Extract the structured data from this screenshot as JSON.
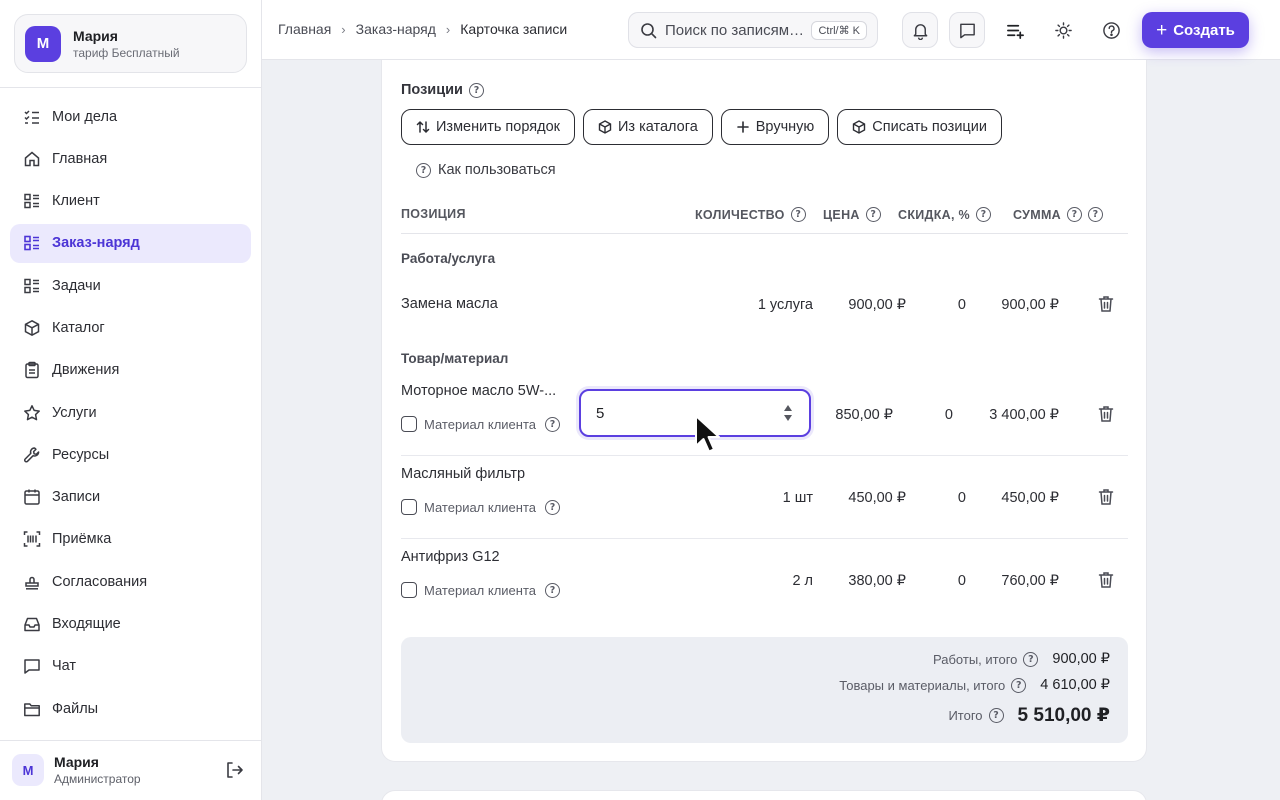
{
  "account": {
    "initial": "М",
    "name": "Мария",
    "plan": "тариф Бесплатный"
  },
  "nav": [
    {
      "label": "Мои дела",
      "icon": "checklist-icon"
    },
    {
      "label": "Главная",
      "icon": "home-icon"
    },
    {
      "label": "Клиент",
      "icon": "list-icon"
    },
    {
      "label": "Заказ-наряд",
      "icon": "list-icon",
      "active": true
    },
    {
      "label": "Задачи",
      "icon": "list-icon"
    },
    {
      "label": "Каталог",
      "icon": "cube-icon"
    },
    {
      "label": "Движения",
      "icon": "clipboard-icon"
    },
    {
      "label": "Услуги",
      "icon": "star-icon"
    },
    {
      "label": "Ресурсы",
      "icon": "wrench-icon"
    },
    {
      "label": "Записи",
      "icon": "calendar-icon"
    },
    {
      "label": "Приёмка",
      "icon": "barcode-icon"
    },
    {
      "label": "Согласования",
      "icon": "stamp-icon"
    },
    {
      "label": "Входящие",
      "icon": "inbox-icon"
    },
    {
      "label": "Чат",
      "icon": "chat-icon"
    },
    {
      "label": "Файлы",
      "icon": "folder-icon"
    }
  ],
  "user": {
    "initial": "М",
    "name": "Мария",
    "role": "Администратор"
  },
  "breadcrumbs": [
    "Главная",
    "Заказ-наряд",
    "Карточка записи"
  ],
  "search": {
    "placeholder": "Поиск по записям…",
    "shortcut": "Ctrl/⌘ K"
  },
  "header": {
    "create_label": "Создать"
  },
  "positions": {
    "title": "Позиции",
    "toolbar": [
      "Изменить порядок",
      "Из каталога",
      "Вручную",
      "Списать позиции"
    ],
    "howto": "Как пользоваться",
    "columns": {
      "position": "ПОЗИЦИЯ",
      "qty": "КОЛИЧЕСТВО",
      "price": "ЦЕНА",
      "discount": "СКИДКА, %",
      "sum": "СУММА"
    },
    "group_work": "Работа/услуга",
    "group_goods": "Товар/материал",
    "client_material": "Материал клиента",
    "rows": [
      {
        "name": "Замена масла",
        "qty": "1 услуга",
        "price": "900,00 ₽",
        "discount": "0",
        "sum": "900,00 ₽"
      },
      {
        "name": "Моторное масло 5W-...",
        "qty": "5",
        "price": "850,00 ₽",
        "discount": "0",
        "sum": "3 400,00 ₽"
      },
      {
        "name": "Масляный фильтр",
        "qty": "1 шт",
        "price": "450,00 ₽",
        "discount": "0",
        "sum": "450,00 ₽"
      },
      {
        "name": "Антифриз G12",
        "qty": "2 л",
        "price": "380,00 ₽",
        "discount": "0",
        "sum": "760,00 ₽"
      }
    ]
  },
  "summary": {
    "work_label": "Работы, итого",
    "work_value": "900,00 ₽",
    "goods_label": "Товары и материалы, итого",
    "goods_value": "4 610,00 ₽",
    "total_label": "Итого",
    "total_value": "5 510,00 ₽"
  },
  "colors": {
    "accent": "#5b3fe0",
    "accent_light": "#ebe9fd"
  }
}
